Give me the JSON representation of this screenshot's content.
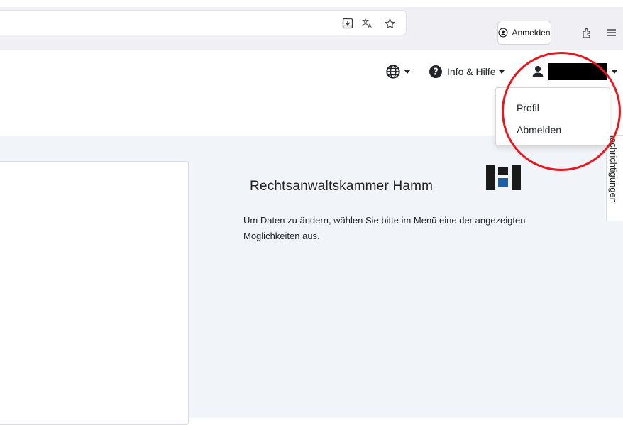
{
  "browser": {
    "signin_label": "Anmelden",
    "icons": [
      "reader-mode-icon",
      "translate-icon",
      "bookmark-star-icon",
      "account-icon",
      "extensions-icon",
      "menu-icon"
    ]
  },
  "navbar": {
    "info_label": "Info & Hilfe"
  },
  "user_menu": {
    "items": [
      {
        "label": "Profil"
      },
      {
        "label": "Abmelden"
      }
    ]
  },
  "main": {
    "organization": "Rechtsanwaltskammer Hamm",
    "message": "Um Daten zu ändern, wählen Sie bitte im Menü eine der angezeigten Möglichkeiten aus.",
    "side_tab": "Benachrichtigungen"
  },
  "colors": {
    "annotation": "#e8171f",
    "logo_dark": "#1a1a1a",
    "logo_blue": "#1f5fa8",
    "content_bg": "#f1f4f8"
  }
}
